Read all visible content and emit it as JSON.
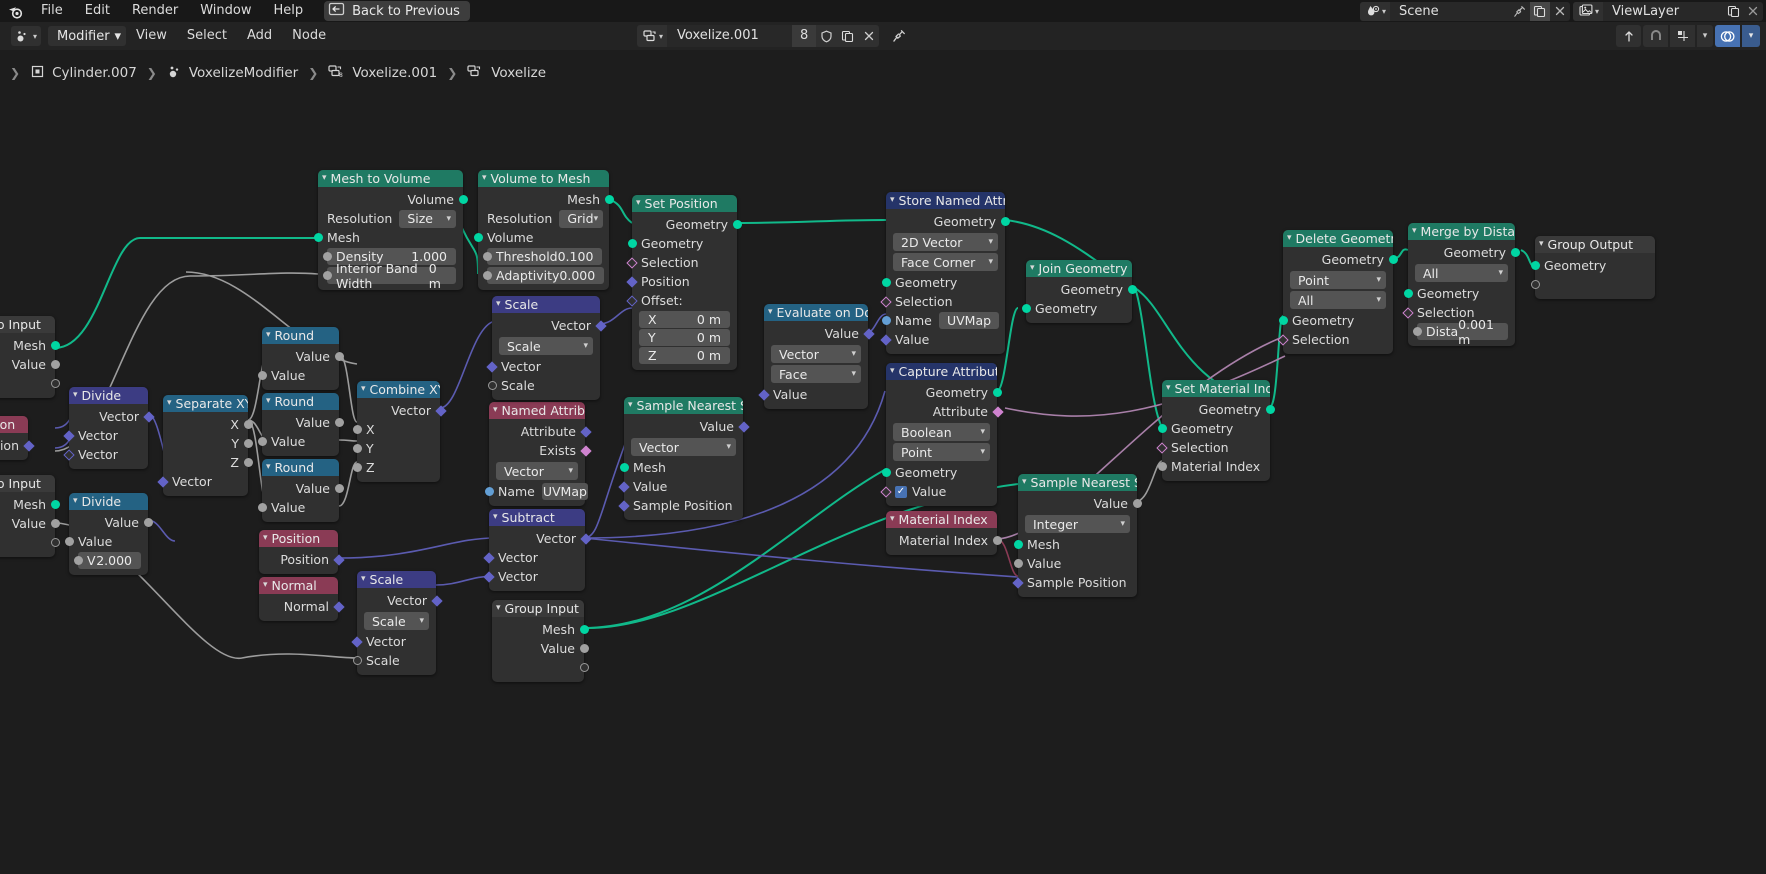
{
  "topbar": {
    "logo_icon": "blender-logo-icon",
    "menus": [
      "File",
      "Edit",
      "Render",
      "Window",
      "Help"
    ],
    "back_button": {
      "label": "Back to Previous",
      "icon": "back-arrow-icon"
    },
    "scene_field": {
      "icon": "scene-icon",
      "name": "Scene",
      "pin_icon": "pin-icon",
      "copy_icon": "duplicate-icon",
      "close_icon": "x-icon"
    },
    "viewlayer_field": {
      "icon": "viewlayer-icon",
      "name": "ViewLayer",
      "copy_icon": "duplicate-icon",
      "close_icon": "x-icon"
    }
  },
  "editor_header": {
    "editor_type_icon": "geometry-nodes-editor-icon",
    "context_select": "Modifier",
    "menus": [
      "View",
      "Select",
      "Add",
      "Node"
    ],
    "node_group": {
      "icon": "node-tree-icon",
      "name": "Voxelize.001",
      "users": "8",
      "shield_icon": "fake-user-icon",
      "copy_icon": "new-nodetree-icon",
      "close_icon": "unlink-icon",
      "pin_icon": "pin-icon"
    },
    "right_buttons": [
      "up-arrow-icon",
      "snap-magnet-icon",
      "snapping-icon",
      "chevron-down-icon",
      "overlays-icon",
      "overlays-chevron-icon"
    ]
  },
  "breadcrumb": [
    {
      "icon": "object-icon",
      "label": "Cylinder.007"
    },
    {
      "icon": "modifier-icon",
      "label": "VoxelizeModifier"
    },
    {
      "icon": "nodetree-icon",
      "label": "Voxelize.001"
    },
    {
      "icon": "nodetree-icon",
      "label": "Voxelize"
    }
  ],
  "nodes": {
    "mesh_to_volume": {
      "title": "Mesh to Volume",
      "outputs": [
        "Volume"
      ],
      "resolution_label": "Resolution",
      "resolution_value": "Size",
      "mesh_label": "Mesh",
      "density_label": "Density",
      "density_value": "1.000",
      "band_label": "Interior Band Width",
      "band_value": "0 m"
    },
    "volume_to_mesh": {
      "title": "Volume to Mesh",
      "outputs": [
        "Mesh"
      ],
      "resolution_label": "Resolution",
      "resolution_value": "Grid",
      "volume_label": "Volume",
      "threshold_label": "Threshold",
      "threshold_value": "0.100",
      "adaptivity_label": "Adaptivity",
      "adaptivity_value": "0.000"
    },
    "set_position": {
      "title": "Set Position",
      "outputs": [
        "Geometry"
      ],
      "inputs": [
        "Geometry",
        "Selection",
        "Position",
        "Offset:"
      ],
      "offset": [
        {
          "axis": "X",
          "value": "0 m"
        },
        {
          "axis": "Y",
          "value": "0 m"
        },
        {
          "axis": "Z",
          "value": "0 m"
        }
      ]
    },
    "store_named_attribute": {
      "title": "Store Named Attribute",
      "outputs": [
        "Geometry"
      ],
      "data_type": "2D Vector",
      "domain": "Face Corner",
      "inputs": [
        "Geometry",
        "Selection",
        "Name",
        "Value"
      ],
      "name_value": "UVMap"
    },
    "capture_attribute": {
      "title": "Capture Attribute",
      "outputs": [
        "Geometry",
        "Attribute"
      ],
      "data_type": "Boolean",
      "domain": "Point",
      "inputs": [
        "Geometry",
        "Value"
      ],
      "value_checked": true
    },
    "evaluate_on_domain": {
      "title": "Evaluate on Domain",
      "outputs": [
        "Value"
      ],
      "data_type": "Vector",
      "domain": "Face",
      "inputs": [
        "Value"
      ]
    },
    "join_geometry": {
      "title": "Join Geometry",
      "outputs": [
        "Geometry"
      ],
      "inputs": [
        "Geometry"
      ]
    },
    "material_index": {
      "title": "Material Index",
      "outputs": [
        "Material Index"
      ]
    },
    "sample_nearest_surface_top": {
      "title": "Sample Nearest Surface",
      "outputs": [
        "Value"
      ],
      "data_type": "Vector",
      "inputs": [
        "Mesh",
        "Value",
        "Sample Position"
      ]
    },
    "sample_nearest_surface_bottom": {
      "title": "Sample Nearest Surf...",
      "outputs": [
        "Value"
      ],
      "data_type": "Integer",
      "inputs": [
        "Mesh",
        "Value",
        "Sample Position"
      ]
    },
    "set_material_index": {
      "title": "Set Material Index",
      "outputs": [
        "Geometry"
      ],
      "inputs": [
        "Geometry",
        "Selection",
        "Material Index"
      ]
    },
    "delete_geometry": {
      "title": "Delete Geometry",
      "outputs": [
        "Geometry"
      ],
      "domain": "Point",
      "mode": "All",
      "inputs": [
        "Geometry",
        "Selection"
      ]
    },
    "merge_by_distance": {
      "title": "Merge by Distance",
      "outputs": [
        "Geometry"
      ],
      "mode": "All",
      "inputs": [
        "Geometry",
        "Selection"
      ],
      "distance_label": "Dista",
      "distance_value": "0.001 m"
    },
    "group_output": {
      "title": "Group Output",
      "inputs": [
        "Geometry"
      ]
    },
    "named_attribute": {
      "title": "Named Attribute",
      "outputs": [
        "Attribute",
        "Exists"
      ],
      "data_type": "Vector",
      "name_label": "Name",
      "name_value": "UVMap"
    },
    "subtract": {
      "title": "Subtract",
      "outputs": [
        "Vector"
      ],
      "inputs": [
        "Vector",
        "Vector"
      ]
    },
    "scale_top": {
      "title": "Scale",
      "outputs": [
        "Vector"
      ],
      "operation": "Scale",
      "inputs": [
        "Vector",
        "Scale"
      ]
    },
    "scale_bottom": {
      "title": "Scale",
      "outputs": [
        "Vector"
      ],
      "operation": "Scale",
      "inputs": [
        "Vector",
        "Scale"
      ]
    },
    "combine_xyz": {
      "title": "Combine XYZ",
      "outputs": [
        "Vector"
      ],
      "inputs": [
        "X",
        "Y",
        "Z"
      ]
    },
    "separate_xyz": {
      "title": "Separate XYZ",
      "outputs": [
        "X",
        "Y",
        "Z"
      ],
      "inputs": [
        "Vector"
      ]
    },
    "round_1": {
      "title": "Round",
      "outputs": [
        "Value"
      ],
      "inputs": [
        "Value"
      ]
    },
    "round_2": {
      "title": "Round",
      "outputs": [
        "Value"
      ],
      "inputs": [
        "Value"
      ]
    },
    "round_3": {
      "title": "Round",
      "outputs": [
        "Value"
      ],
      "inputs": [
        "Value"
      ]
    },
    "divide_1": {
      "title": "Divide",
      "outputs": [
        "Vector"
      ],
      "inputs": [
        "Vector",
        "Vector"
      ]
    },
    "divide_2": {
      "title": "Divide",
      "outputs": [
        "Value"
      ],
      "inputs": [
        "Value"
      ],
      "value_label": "V",
      "value_value": "2.000"
    },
    "position": {
      "title": "Position",
      "outputs": [
        "Position"
      ]
    },
    "normal": {
      "title": "Normal",
      "outputs": [
        "Normal"
      ]
    },
    "group_input_1": {
      "title": "Group Input",
      "outputs": [
        "Mesh",
        "Value"
      ]
    },
    "group_input_2": {
      "title": "Group Input",
      "outputs": [
        "Mesh",
        "Value"
      ]
    },
    "group_input_3": {
      "title": "Group Input",
      "outputs": [
        "Mesh",
        "Value"
      ]
    },
    "position_left": {
      "title": "Position",
      "outputs": [
        "Position"
      ]
    }
  },
  "colors": {
    "geometry_header": "#1f7a63",
    "vector_header": "#3c3c83",
    "converter_header": "#246283",
    "attribute_header": "#253469",
    "input_header": "#8a3b55",
    "geo_socket": "#00d6a3",
    "vec_socket": "#6363c7",
    "bool_socket": "#cf83cf",
    "accent_blue": "#4772b3"
  }
}
